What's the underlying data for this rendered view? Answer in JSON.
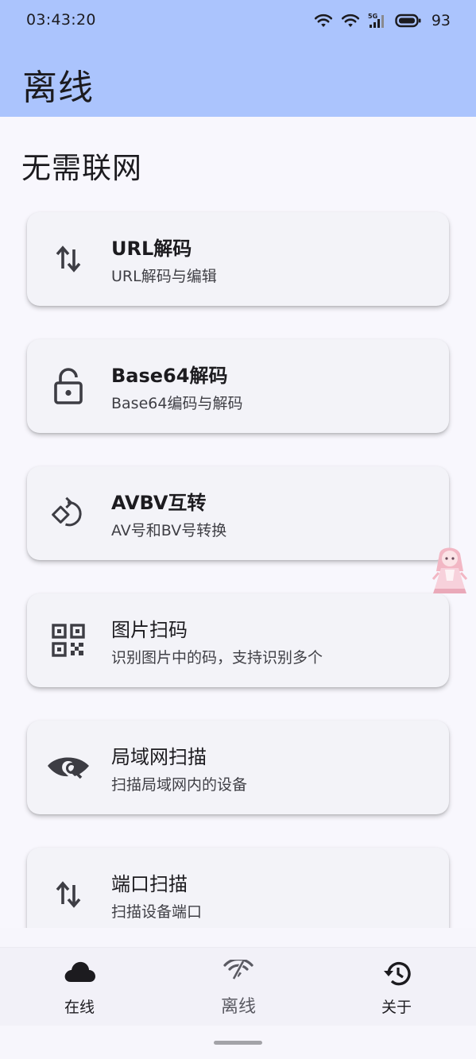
{
  "status_bar": {
    "time": "03:43:20",
    "network_label": "5G",
    "battery": "93",
    "icons": [
      "wifi-icon",
      "hotspot-icon",
      "signal-5g-icon",
      "battery-icon"
    ]
  },
  "app_bar": {
    "title": "离线",
    "background": "#abc4fd"
  },
  "section": {
    "title": "无需联网"
  },
  "cards": [
    {
      "icon": "swap-vertical-icon",
      "title": "URL解码",
      "subtitle": "URL解码与编辑",
      "title_bold": true
    },
    {
      "icon": "lock-open-icon",
      "title": "Base64解码",
      "subtitle": "Base64编码与解码",
      "title_bold": true
    },
    {
      "icon": "rotate-convert-icon",
      "title": "AVBV互转",
      "subtitle": "AV号和BV号转换",
      "title_bold": true
    },
    {
      "icon": "qr-code-icon",
      "title": "图片扫码",
      "subtitle": "识别图片中的码，支持识别多个",
      "title_bold": false
    },
    {
      "icon": "eye-search-icon",
      "title": "局域网扫描",
      "subtitle": "扫描局域网内的设备",
      "title_bold": false
    },
    {
      "icon": "swap-vertical-icon",
      "title": "端口扫描",
      "subtitle": "扫描设备端口",
      "title_bold": false
    }
  ],
  "bottom_nav": {
    "items": [
      {
        "icon": "cloud-icon",
        "label": "在线",
        "active": false
      },
      {
        "icon": "wifi-off-icon",
        "label": "离线",
        "active": true
      },
      {
        "icon": "history-icon",
        "label": "关于",
        "active": false
      }
    ]
  }
}
